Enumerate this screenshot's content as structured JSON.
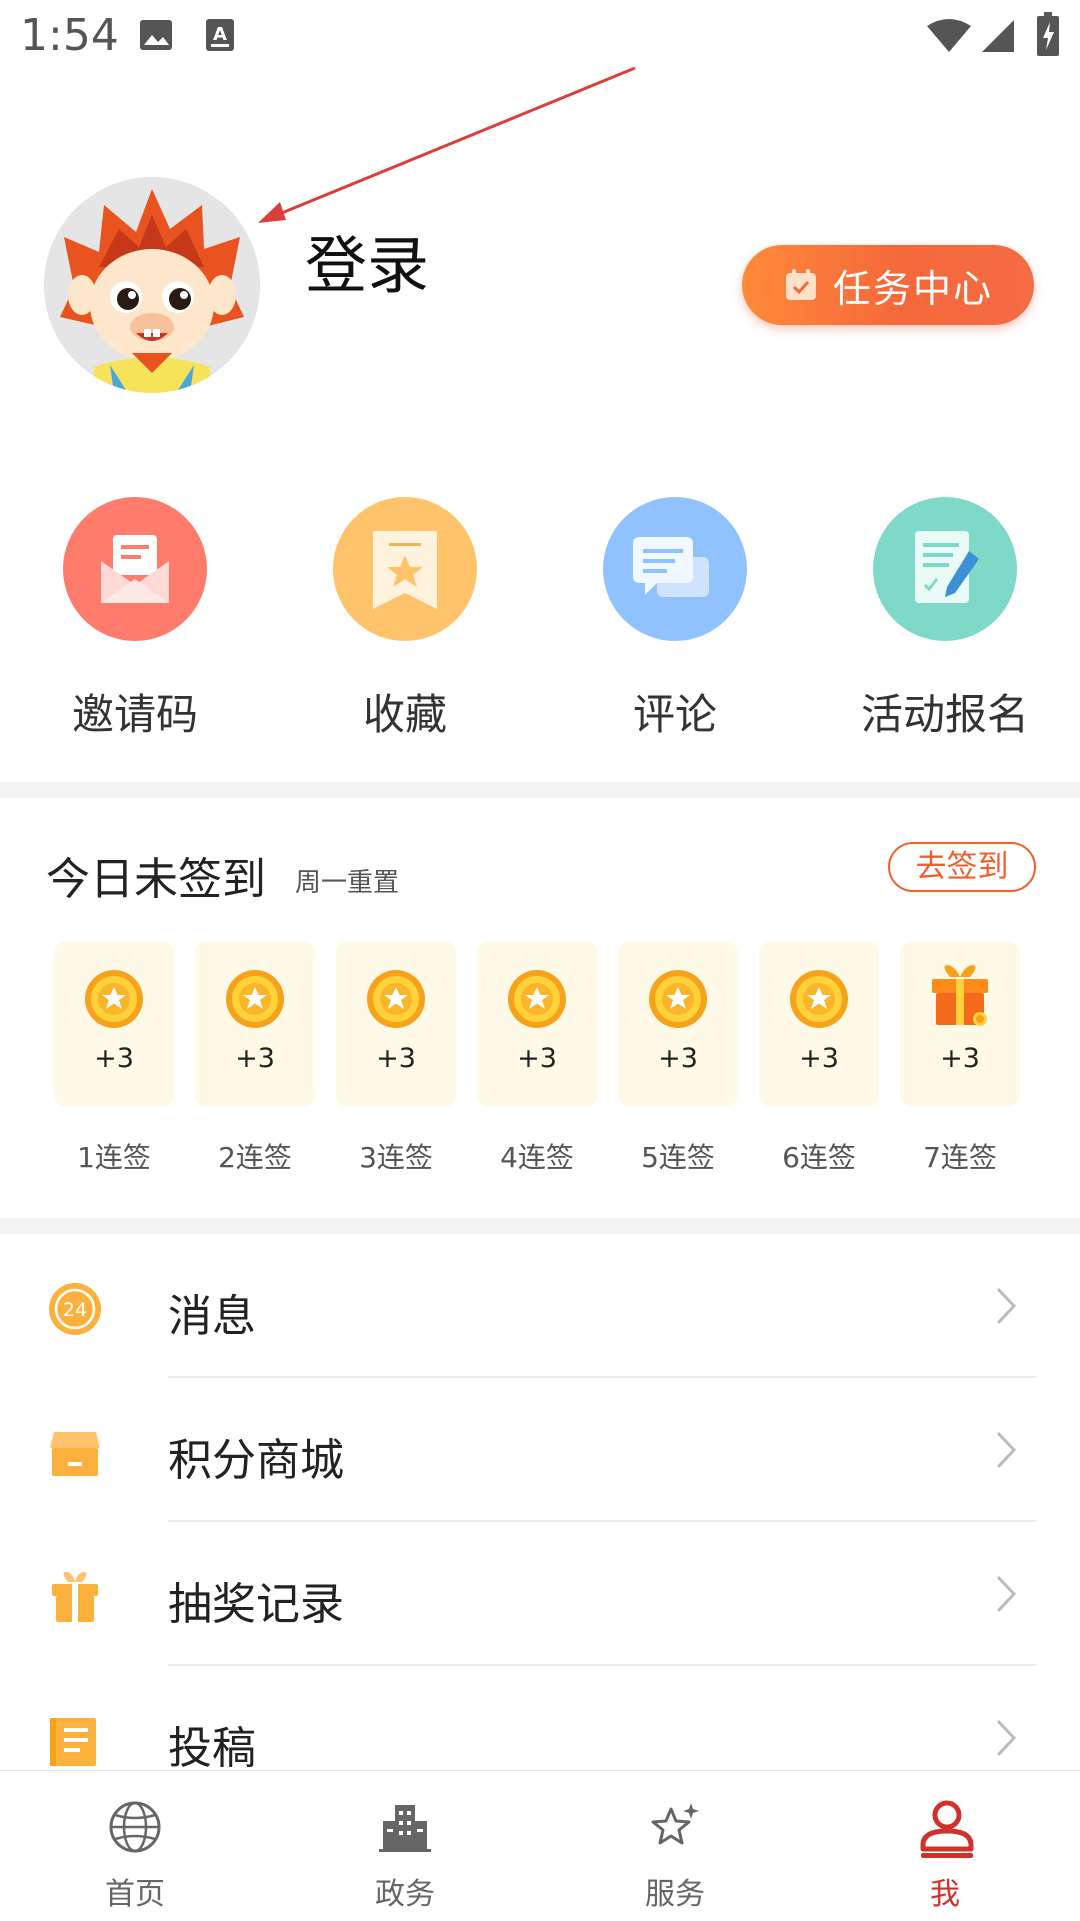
{
  "status_bar": {
    "time": "1:54",
    "icons": [
      "image-icon",
      "keyboard-a-icon",
      "wifi-icon",
      "signal-icon",
      "battery-charging-icon"
    ]
  },
  "profile": {
    "login_label": "登录",
    "task_center_label": "任务中心"
  },
  "quick_actions": [
    {
      "label": "邀请码",
      "icon": "envelope-icon",
      "color": "#ff7b6b"
    },
    {
      "label": "收藏",
      "icon": "bookmark-icon",
      "color": "#ffc36b"
    },
    {
      "label": "评论",
      "icon": "chat-icon",
      "color": "#8fc2ff"
    },
    {
      "label": "活动报名",
      "icon": "form-pen-icon",
      "color": "#7fd9c8"
    }
  ],
  "sign_in": {
    "title": "今日未签到",
    "subtitle": "周一重置",
    "button": "去签到",
    "days": [
      {
        "points": "+3",
        "label": "1连签",
        "icon": "coin-star-icon"
      },
      {
        "points": "+3",
        "label": "2连签",
        "icon": "coin-star-icon"
      },
      {
        "points": "+3",
        "label": "3连签",
        "icon": "coin-star-icon"
      },
      {
        "points": "+3",
        "label": "4连签",
        "icon": "coin-star-icon"
      },
      {
        "points": "+3",
        "label": "5连签",
        "icon": "coin-star-icon"
      },
      {
        "points": "+3",
        "label": "6连签",
        "icon": "coin-star-icon"
      },
      {
        "points": "+3",
        "label": "7连签",
        "icon": "gift-box-icon"
      }
    ]
  },
  "menu": [
    {
      "label": "消息",
      "icon": "clock-24-icon"
    },
    {
      "label": "积分商城",
      "icon": "shop-icon"
    },
    {
      "label": "抽奖记录",
      "icon": "gift-icon"
    },
    {
      "label": "投稿",
      "icon": "notebook-icon"
    }
  ],
  "bottom_nav": [
    {
      "label": "首页",
      "icon": "globe-icon"
    },
    {
      "label": "政务",
      "icon": "building-icon"
    },
    {
      "label": "服务",
      "icon": "star-sparkle-icon"
    },
    {
      "label": "我",
      "icon": "person-icon",
      "active": true
    }
  ],
  "colors": {
    "accent": "#f0602c",
    "active_tab": "#d0322b",
    "sign_card_bg": "#fff9e8"
  }
}
